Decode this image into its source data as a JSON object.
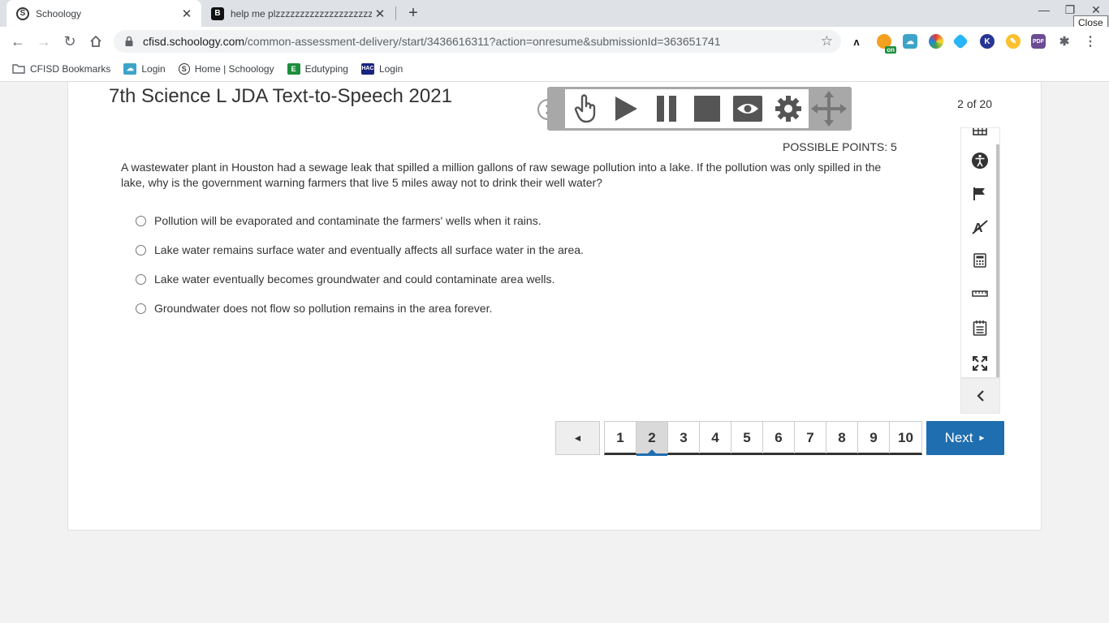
{
  "browser": {
    "tabs": [
      {
        "title": "Schoology",
        "favicon": "S",
        "active": true
      },
      {
        "title": "help me plzzzzzzzzzzzzzzzzzzzz",
        "favicon": "B",
        "active": false
      }
    ],
    "tooltip": "Close",
    "url_host": "cfisd.schoology.com",
    "url_path": "/common-assessment-delivery/start/3436616311?action=onresume&submissionId=363651741",
    "bookmarks": [
      {
        "label": "CFISD Bookmarks",
        "icon": "folder-icon"
      },
      {
        "label": "Login",
        "icon": "cloud-icon"
      },
      {
        "label": "Home | Schoology",
        "icon": "schoology-icon"
      },
      {
        "label": "Edutyping",
        "icon": "edutyping-icon"
      },
      {
        "label": "Login",
        "icon": "hac-icon"
      }
    ],
    "ext_badge": "on"
  },
  "assessment": {
    "title": "7th Science L JDA Text-to-Speech 2021",
    "counter": "2 of 20",
    "points": "POSSIBLE POINTS: 5",
    "question": "A wastewater plant in Houston had a sewage leak that spilled a million gallons of raw sewage pollution into a lake. If the pollution was only spilled in the lake, why is the government warning farmers that live 5 miles away not to drink their well water?",
    "choices": [
      "Pollution will be evaporated and contaminate the farmers' wells when it rains.",
      "Lake water remains surface water and eventually affects all surface water in the area.",
      "Lake water eventually becomes groundwater and could contaminate area wells.",
      "Groundwater does not flow so pollution remains in the area forever."
    ]
  },
  "pagination": {
    "prev": "◄",
    "pages": [
      "1",
      "2",
      "3",
      "4",
      "5",
      "6",
      "7",
      "8",
      "9",
      "10"
    ],
    "current_page": "2",
    "next_label": "Next",
    "next_arrow": "►"
  },
  "colors": {
    "accent": "#1f6eaf",
    "tts_frame": "#a8a8a8"
  }
}
